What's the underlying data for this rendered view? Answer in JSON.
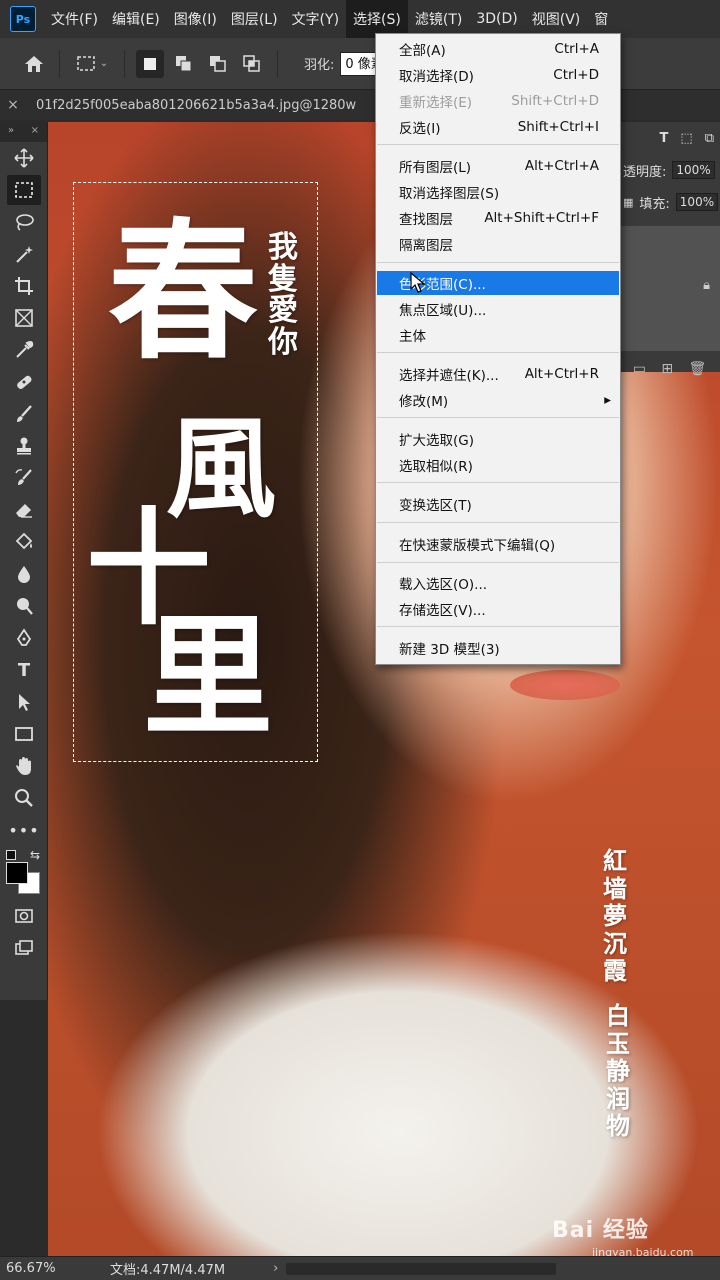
{
  "app": {
    "logo_text": "Ps"
  },
  "menubar": {
    "items": [
      "文件(F)",
      "编辑(E)",
      "图像(I)",
      "图层(L)",
      "文字(Y)",
      "选择(S)",
      "滤镜(T)",
      "3D(D)",
      "视图(V)",
      "窗"
    ],
    "active_index": 5
  },
  "options": {
    "feather_label": "羽化:",
    "feather_value": "0 像素"
  },
  "tab": {
    "close": "×",
    "title": "01f2d25f005eaba801206621b5a3a4.jpg@1280w"
  },
  "toolbox": {
    "header_left": "»",
    "header_right": "×"
  },
  "canvas_text": {
    "big1": "春",
    "big2": "風",
    "big3": "十",
    "big4": "里",
    "small_vertical": "我隻愛你",
    "poem1": "紅墙夢沉霞",
    "poem2": "白玉静润物"
  },
  "panels": {
    "opacity_label": "透明度:",
    "opacity_value": "100%",
    "fill_label": "填充:",
    "fill_value": "100%"
  },
  "dropdown": {
    "items": [
      {
        "label": "全部(A)",
        "shortcut": "Ctrl+A",
        "disabled": false
      },
      {
        "label": "取消选择(D)",
        "shortcut": "Ctrl+D",
        "disabled": false
      },
      {
        "label": "重新选择(E)",
        "shortcut": "Shift+Ctrl+D",
        "disabled": true
      },
      {
        "label": "反选(I)",
        "shortcut": "Shift+Ctrl+I",
        "disabled": false
      },
      {
        "label": "所有图层(L)",
        "shortcut": "Alt+Ctrl+A",
        "disabled": false
      },
      {
        "label": "取消选择图层(S)",
        "shortcut": "",
        "disabled": false
      },
      {
        "label": "查找图层",
        "shortcut": "Alt+Shift+Ctrl+F",
        "disabled": false
      },
      {
        "label": "隔离图层",
        "shortcut": "",
        "disabled": false
      },
      {
        "label": "色彩范围(C)...",
        "shortcut": "",
        "disabled": false,
        "highlighted": true
      },
      {
        "label": "焦点区域(U)...",
        "shortcut": "",
        "disabled": false
      },
      {
        "label": "主体",
        "shortcut": "",
        "disabled": false
      },
      {
        "label": "选择并遮住(K)...",
        "shortcut": "Alt+Ctrl+R",
        "disabled": false
      },
      {
        "label": "修改(M)",
        "shortcut": "▸",
        "disabled": false
      },
      {
        "label": "扩大选取(G)",
        "shortcut": "",
        "disabled": false
      },
      {
        "label": "选取相似(R)",
        "shortcut": "",
        "disabled": false
      },
      {
        "label": "变换选区(T)",
        "shortcut": "",
        "disabled": false
      },
      {
        "label": "在快速蒙版模式下编辑(Q)",
        "shortcut": "",
        "disabled": false
      },
      {
        "label": "载入选区(O)...",
        "shortcut": "",
        "disabled": false
      },
      {
        "label": "存储选区(V)...",
        "shortcut": "",
        "disabled": false
      },
      {
        "label": "新建 3D 模型(3)",
        "shortcut": "",
        "disabled": false
      }
    ]
  },
  "status": {
    "zoom": "66.67%",
    "doc": "文档:4.47M/4.47M",
    "arrow": "›"
  },
  "watermark": {
    "main": "Bai 经验",
    "sub": "jingyan.baidu.com"
  }
}
